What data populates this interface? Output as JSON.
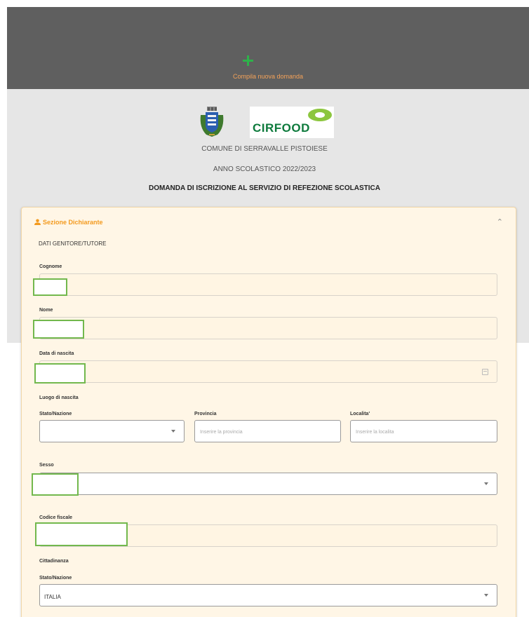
{
  "header": {
    "new_application": "Compila nuova domanda"
  },
  "org": {
    "comune": "COMUNE DI SERRAVALLE PISTOIESE",
    "anno": "ANNO SCOLASTICO 2022/2023",
    "titolo": "DOMANDA DI ISCRIZIONE AL SERVIZIO DI REFEZIONE SCOLASTICA",
    "cirfood_logo": "CIRFOOD"
  },
  "section": {
    "title": "Sezione Dichiarante",
    "subtitle": "DATI GENITORE/TUTORE"
  },
  "form": {
    "cognome_label": "Cognome",
    "nome_label": "Nome",
    "data_nascita_label": "Data di nascita",
    "luogo_nascita_label": "Luogo di nascita",
    "stato_nazione_label": "Stato/Nazione",
    "provincia_label": "Provincia",
    "provincia_placeholder": "Inserire la provincia",
    "localita_label": "Localita'",
    "localita_placeholder": "Inserire la localita",
    "sesso_label": "Sesso",
    "codice_fiscale_label": "Codice fiscale",
    "cittadinanza_label": "Cittadinanza",
    "cittadinanza_stato_label": "Stato/Nazione",
    "cittadinanza_stato_value": "ITALIA"
  },
  "colors": {
    "header_bg": "#5f5f5f",
    "accent_orange": "#f39a1e",
    "highlight_green": "#72b84d",
    "card_bg": "#fff6e6"
  }
}
